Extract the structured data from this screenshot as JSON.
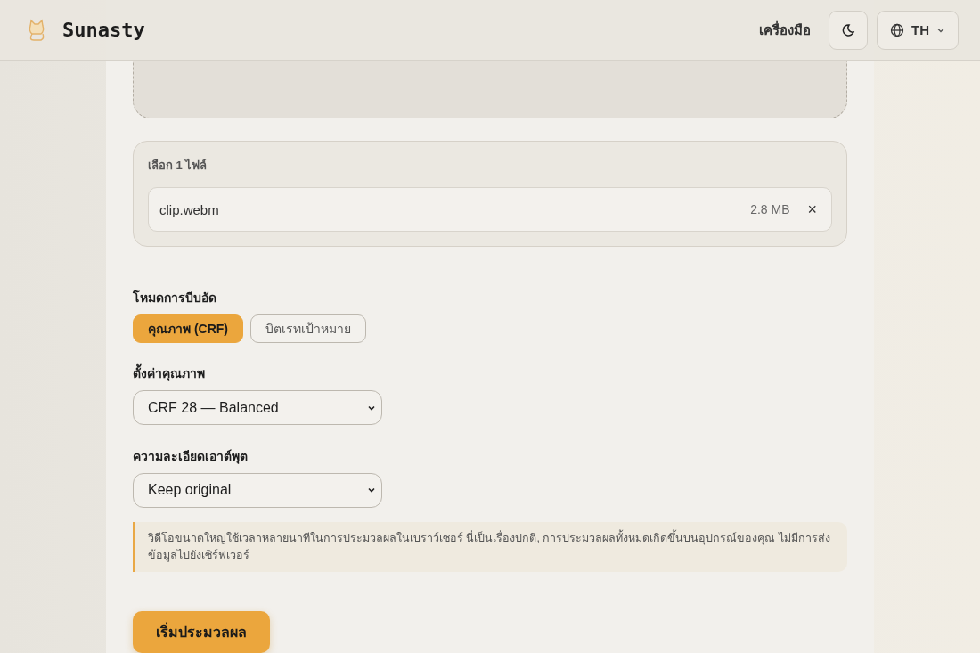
{
  "header": {
    "brand": "Sunasty",
    "tools_link": "เครื่องมือ",
    "language": "TH"
  },
  "selected_files": {
    "heading": "เลือก 1 ไฟล์",
    "files": [
      {
        "name": "clip.webm",
        "size": "2.8 MB",
        "remove": "×"
      }
    ]
  },
  "compression_mode": {
    "label": "โหมดการบีบอัด",
    "options": [
      {
        "label": "คุณภาพ (CRF)",
        "selected": true
      },
      {
        "label": "บิตเรทเป้าหมาย",
        "selected": false
      }
    ]
  },
  "quality": {
    "label": "ตั้งค่าคุณภาพ",
    "value": "CRF 28 — Balanced"
  },
  "resolution": {
    "label": "ความละเอียดเอาต์พุต",
    "value": "Keep original"
  },
  "notice": "วิดีโอขนาดใหญ่ใช้เวลาหลายนาทีในการประมวลผลในเบราว์เซอร์ นี่เป็นเรื่องปกติ, การประมวลผลทั้งหมดเกิดขึ้นบนอุปกรณ์ของคุณ ไม่มีการส่งข้อมูลไปยังเซิร์ฟเวอร์",
  "start_button": "เริ่มประมวลผล"
}
